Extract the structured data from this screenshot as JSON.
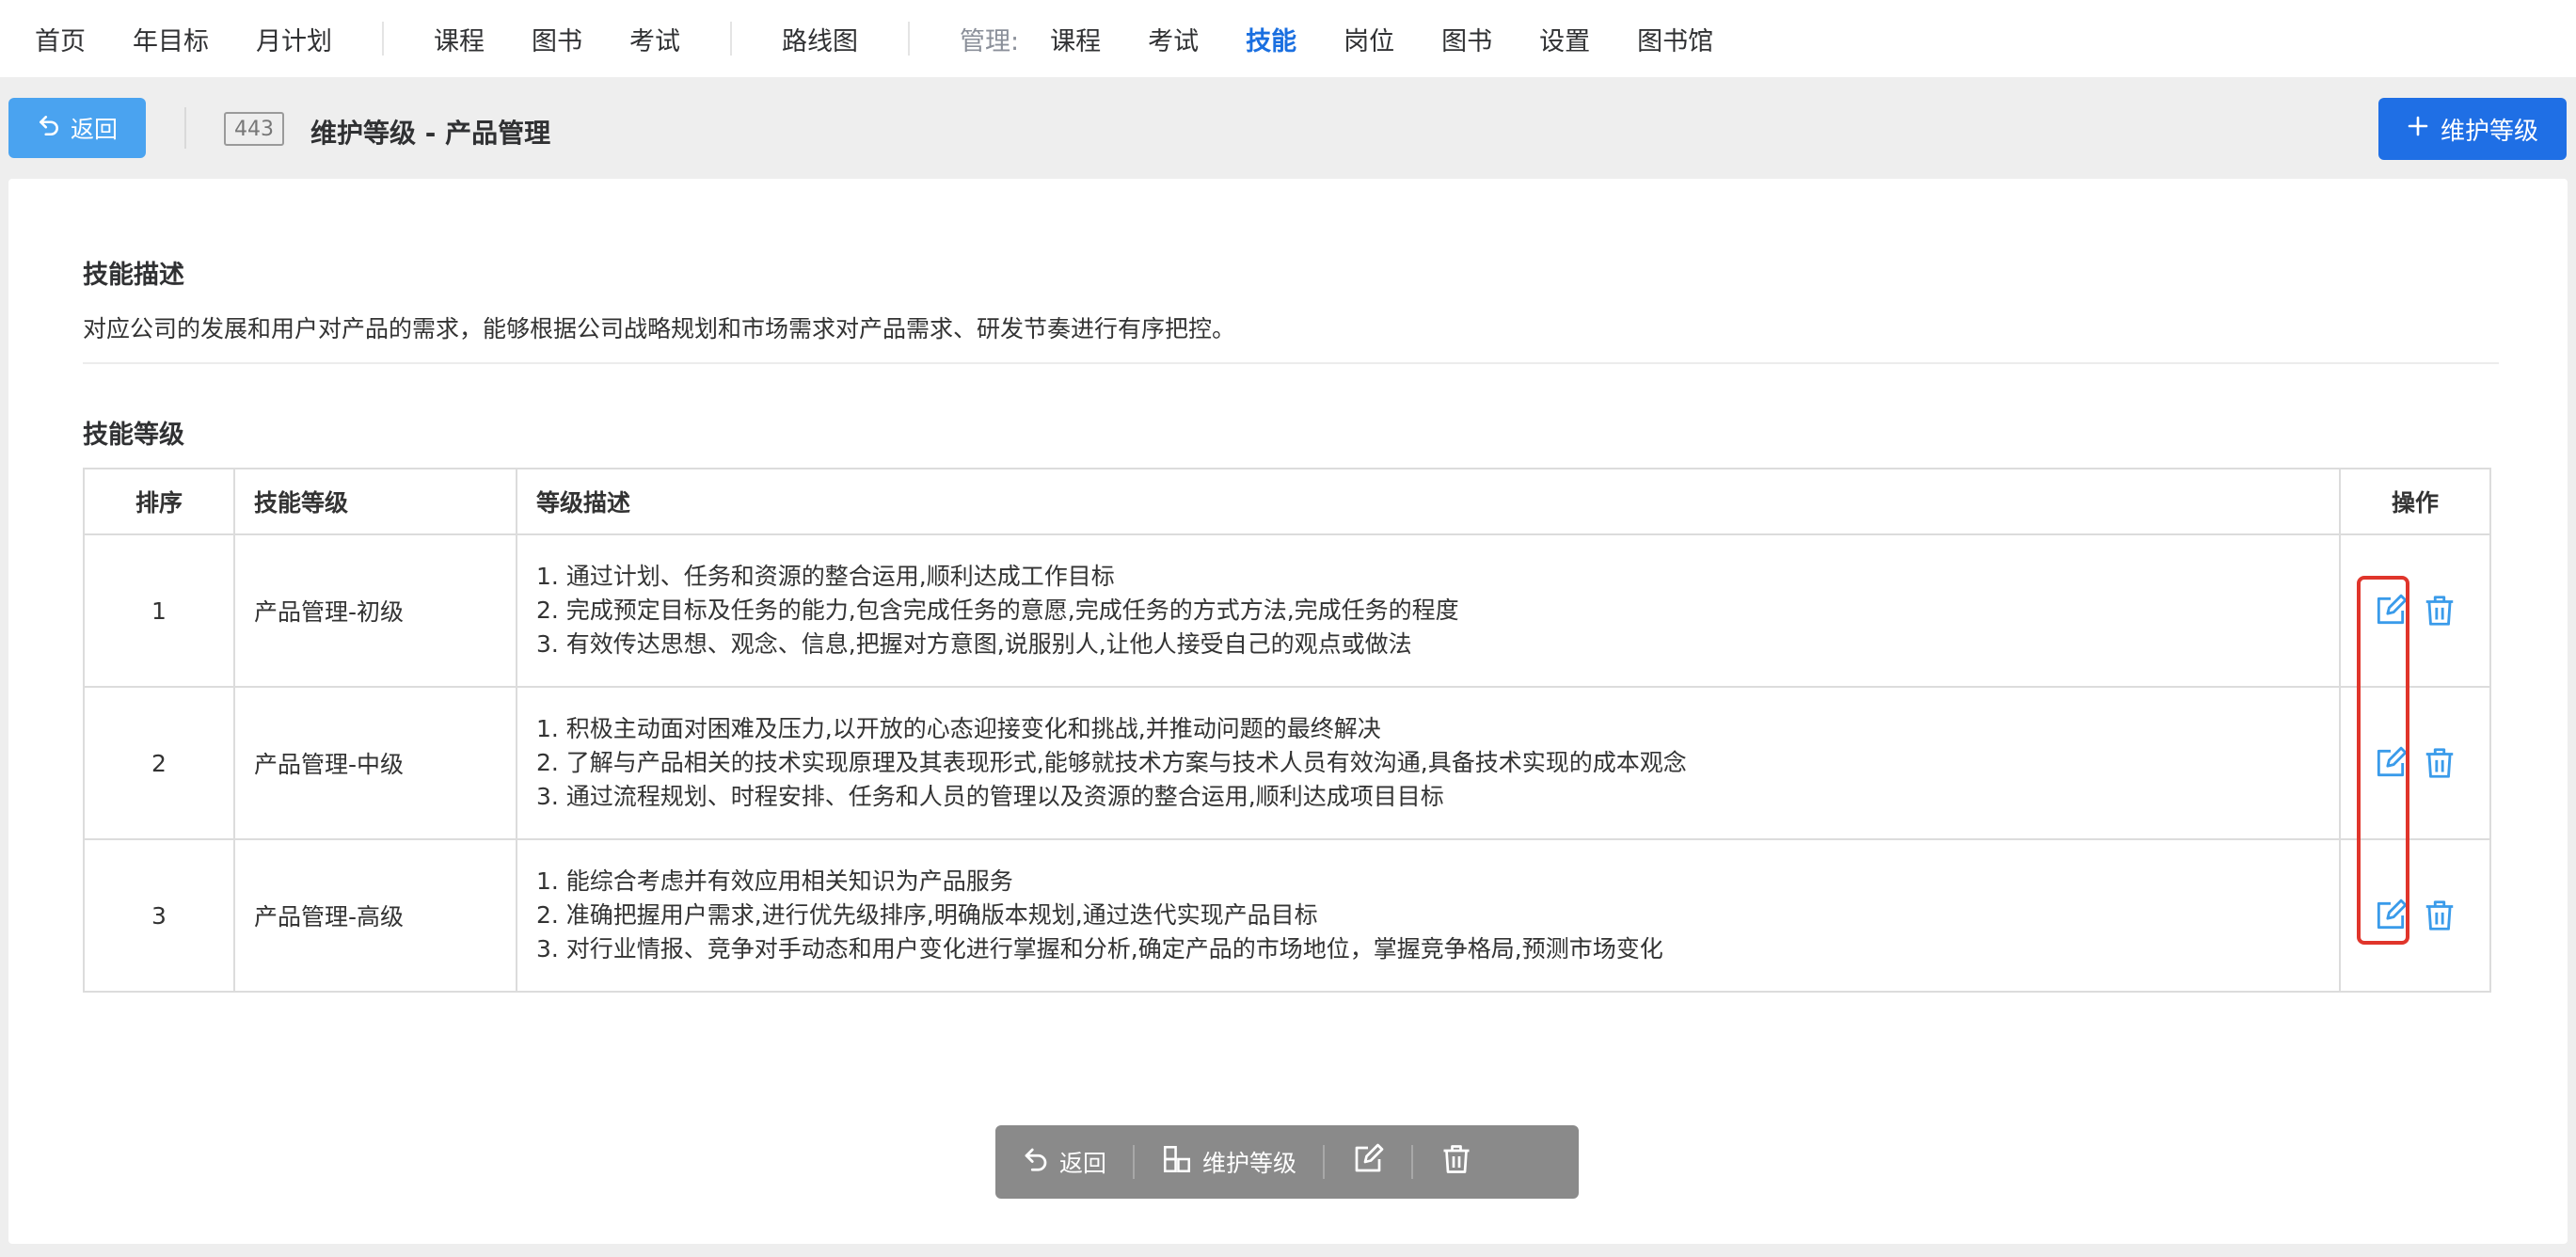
{
  "nav": {
    "items": [
      "首页",
      "年目标",
      "月计划"
    ],
    "items2": [
      "课程",
      "图书",
      "考试"
    ],
    "items3": [
      "路线图"
    ],
    "manage_label": "管理:",
    "manage_items": [
      "课程",
      "考试",
      "技能",
      "岗位",
      "图书",
      "设置",
      "图书馆"
    ],
    "active": "技能"
  },
  "header": {
    "back_label": "返回",
    "id_badge": "443",
    "title": "维护等级 - 产品管理",
    "add_label": "维护等级"
  },
  "skill": {
    "desc_title": "技能描述",
    "desc": "对应公司的发展和用户对产品的需求，能够根据公司战略规划和市场需求对产品需求、研发节奏进行有序把控。",
    "levels_title": "技能等级"
  },
  "table": {
    "headers": [
      "排序",
      "技能等级",
      "等级描述",
      "操作"
    ],
    "rows": [
      {
        "order": "1",
        "level": "产品管理-初级",
        "lines": [
          "1. 通过计划、任务和资源的整合运用,顺利达成工作目标",
          "2. 完成预定目标及任务的能力,包含完成任务的意愿,完成任务的方式方法,完成任务的程度",
          "3. 有效传达思想、观念、信息,把握对方意图,说服别人,让他人接受自己的观点或做法"
        ]
      },
      {
        "order": "2",
        "level": "产品管理-中级",
        "lines": [
          "1. 积极主动面对困难及压力,以开放的心态迎接变化和挑战,并推动问题的最终解决",
          "2. 了解与产品相关的技术实现原理及其表现形式,能够就技术方案与技术人员有效沟通,具备技术实现的成本观念",
          "3. 通过流程规划、时程安排、任务和人员的管理以及资源的整合运用,顺利达成项目目标"
        ]
      },
      {
        "order": "3",
        "level": "产品管理-高级",
        "lines": [
          "1. 能综合考虑并有效应用相关知识为产品服务",
          "2. 准确把握用户需求,进行优先级排序,明确版本规划,通过迭代实现产品目标",
          "3. 对行业情报、竞争对手动态和用户变化进行掌握和分析,确定产品的市场地位，掌握竞争格局,预测市场变化"
        ]
      }
    ],
    "icons": {
      "edit": "edit-icon",
      "delete": "trash-icon"
    }
  },
  "float_bar": {
    "back_label": "返回",
    "manage_label": "维护等级"
  },
  "colors": {
    "accent": "#1f6fe5",
    "back_button": "#4aa3f0",
    "icon_blue": "#3a9bea",
    "highlight": "#e0352b",
    "float_bar": "#8a8a8a"
  }
}
